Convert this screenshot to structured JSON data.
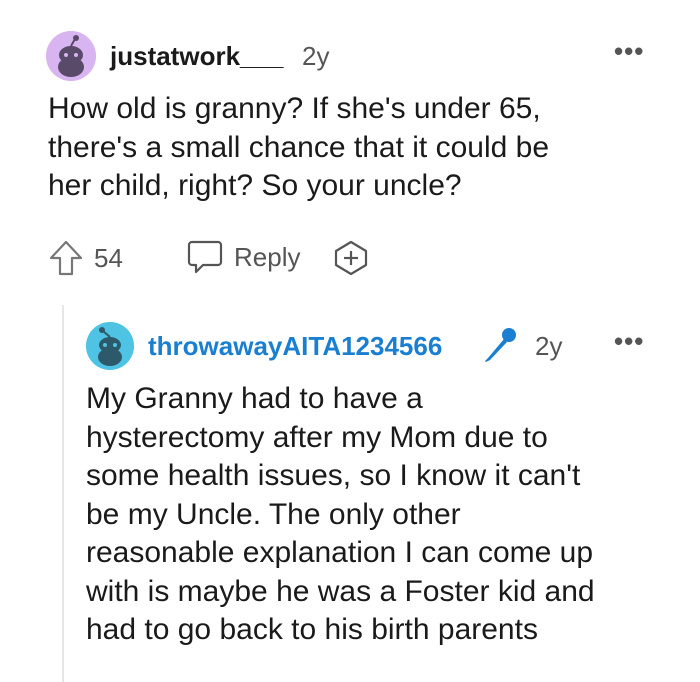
{
  "comment1": {
    "username": "justatwork___",
    "age": "2y",
    "more_label": "•••",
    "body_lines": [
      "How old is granny? If she's under 65,",
      "there's a small chance that it could be",
      "her child, right? So your uncle?"
    ],
    "upvotes": "54",
    "reply_label": "Reply",
    "avatar_color": "#d8b4f0"
  },
  "reply1": {
    "username": "throwawayAITA1234566",
    "age": "2y",
    "more_label": "•••",
    "username_color": "#1a7fd0",
    "mic_color": "#1a7fd0",
    "avatar_color": "#4fc3e3",
    "body_lines": [
      "My Granny had to have a",
      "hysterectomy after my Mom due to",
      "some health issues, so I know it can't",
      "be my Uncle. The only other",
      "reasonable explanation I can come up",
      "with is maybe he was a Foster kid and",
      "had to go back to his birth parents"
    ]
  }
}
